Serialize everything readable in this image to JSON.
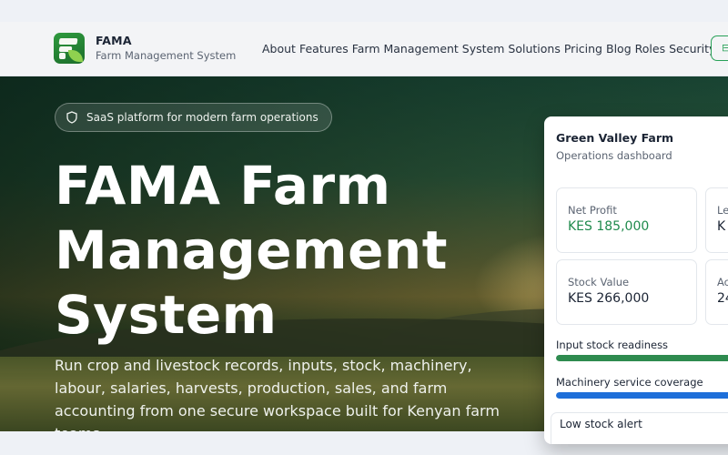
{
  "brand": {
    "name": "FAMA",
    "subtitle": "Farm Management System"
  },
  "nav": {
    "items": [
      "About",
      "Features",
      "Farm Management System",
      "Solutions",
      "Pricing",
      "Blog",
      "Roles",
      "Security"
    ]
  },
  "hero": {
    "badge": "SaaS platform for modern farm operations",
    "title": "FAMA Farm Management System",
    "description": "Run crop and livestock records, inputs, stock, machinery, labour, salaries, harvests, production, sales, and farm accounting from one secure workspace built for Kenyan farm teams."
  },
  "dashboard": {
    "farm_name": "Green Valley Farm",
    "subtitle": "Operations dashboard",
    "metrics": [
      {
        "label": "Net Profit",
        "value": "KES 185,000"
      },
      {
        "label": "Le",
        "value": "K"
      },
      {
        "label": "Stock Value",
        "value": "KES 266,000"
      },
      {
        "label": "Ac",
        "value": "24"
      }
    ],
    "bars": [
      {
        "label": "Input stock readiness",
        "color": "#2e8b4f"
      },
      {
        "label": "Machinery service coverage",
        "color": "#1e6fd9"
      }
    ],
    "alert": "Low stock alert"
  },
  "colors": {
    "brand_green": "#27a157",
    "accent_blue": "#1e6fd9"
  }
}
